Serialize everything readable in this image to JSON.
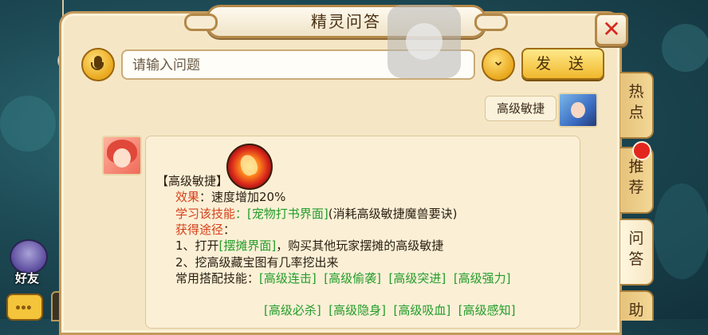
{
  "window": {
    "title": "精灵问答"
  },
  "hud": {
    "friends_label": "好友",
    "chat_icon": "chat-bubble-icon"
  },
  "search": {
    "placeholder": "请输入问题",
    "send_label": "发 送"
  },
  "tabs": [
    {
      "label": "热点",
      "active": false,
      "badge": false
    },
    {
      "label": "推荐",
      "active": false,
      "badge": true
    },
    {
      "label": "问答",
      "active": true,
      "badge": false
    },
    {
      "label": "助",
      "active": false,
      "badge": false
    }
  ],
  "conversation": {
    "user_question": "高级敏捷",
    "answer": {
      "title": "【高级敏捷】",
      "effect_label": "效果",
      "effect_value": "：速度增加20%",
      "learn_label": "学习该技能",
      "learn_link": "：[宠物打书界面]",
      "learn_note": "(消耗高级敏捷魔兽要诀)",
      "obtain_label": "获得途径",
      "obtain_colon": "：",
      "obtain_1_prefix": "1、打开",
      "obtain_1_link": "[摆摊界面]",
      "obtain_1_suffix": "，购买其他玩家摆摊的高级敏捷",
      "obtain_2": "2、挖高级藏宝图有几率挖出来",
      "combo_label": "常用搭配技能：",
      "combo_skills": [
        "[高级连击]",
        "[高级偷袭]",
        "[高级突进]",
        "[高级强力]",
        "[高级必杀]",
        "[高级隐身]",
        "[高级吸血]",
        "[高级感知]"
      ]
    }
  },
  "colors": {
    "highlight_red": "#d6401a",
    "link_green": "#239c2a",
    "close_red": "#d42a1e"
  }
}
